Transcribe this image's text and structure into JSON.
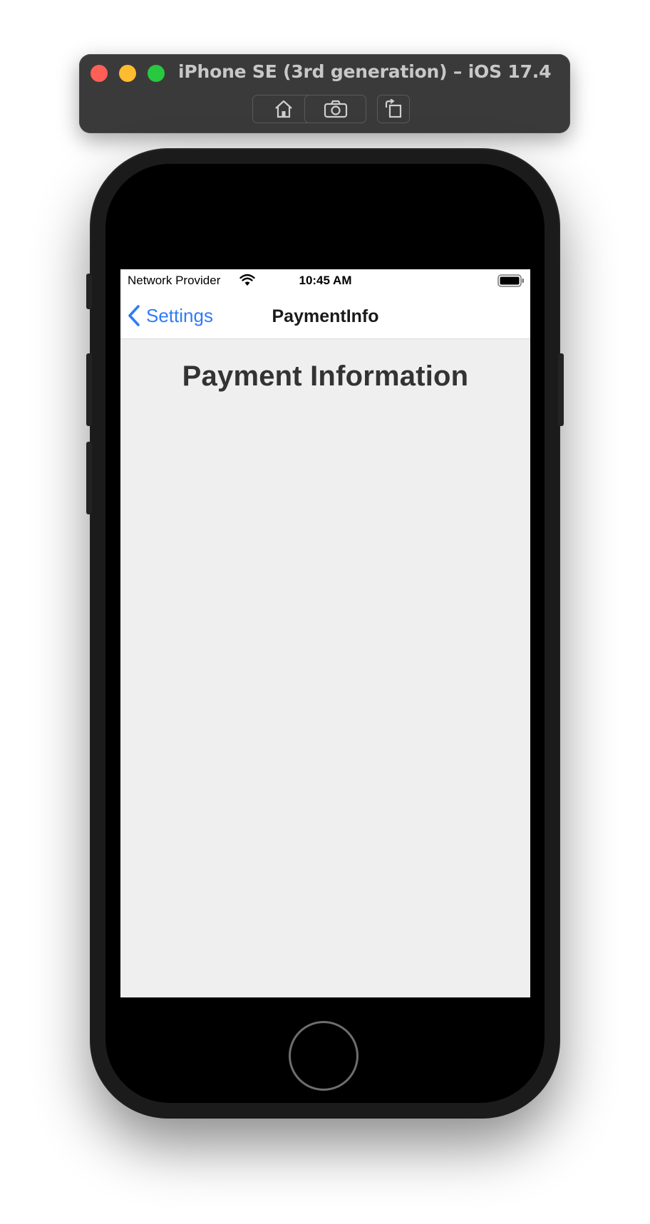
{
  "simulator": {
    "title": "iPhone SE (3rd generation) – iOS 17.4",
    "toolbar": [
      {
        "name": "home-icon"
      },
      {
        "name": "camera-icon"
      },
      {
        "name": "rotate-icon"
      }
    ]
  },
  "status_bar": {
    "carrier": "Network Provider",
    "time": "10:45 AM",
    "icons": [
      "wifi-icon",
      "battery-icon"
    ]
  },
  "nav_bar": {
    "back_label": "Settings",
    "title": "PaymentInfo"
  },
  "content": {
    "heading": "Payment Information"
  },
  "colors": {
    "accent": "#2f7cf6",
    "background": "#efefef",
    "heading": "#333333"
  }
}
